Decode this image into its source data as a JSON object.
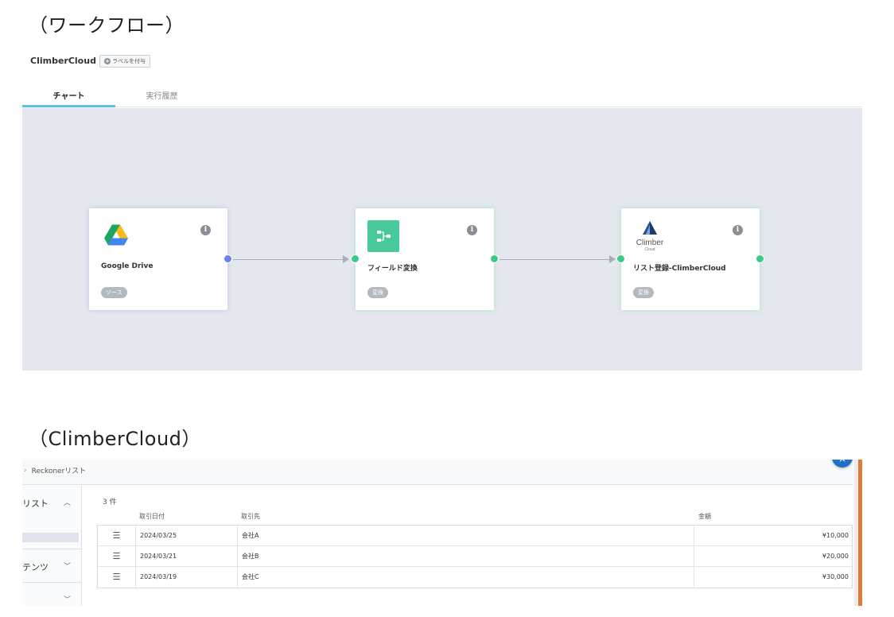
{
  "captions": {
    "workflow": "（ワークフロー）",
    "climbercloud": "（ClimberCloud）"
  },
  "workflow": {
    "title": "ClimberCloud",
    "add_label": "ラベルを付与",
    "tabs": [
      "チャート",
      "実行履歴"
    ],
    "active_tab": "チャート",
    "nodes": [
      {
        "name": "Google Drive",
        "badge": "ソース",
        "icon": "google-drive-icon"
      },
      {
        "name": "フィールド変換",
        "badge": "変換",
        "icon": "transform-icon"
      },
      {
        "name": "リスト登録-ClimberCloud",
        "badge": "変換",
        "icon": "climbercloud-icon",
        "logo_text": "Climber",
        "logo_sub": "Cloud"
      }
    ],
    "colors": {
      "canvas": "#e4e7ed",
      "port_source": "#6f7ff0",
      "port_ok": "#3cc98a",
      "tab_accent": "#5bc1ea",
      "transform_icon": "#47c99a"
    }
  },
  "climbercloud": {
    "breadcrumb": "Reckonerリスト",
    "sidebar": [
      {
        "label": "リスト",
        "chevron": "^"
      },
      {
        "label": "テンツ",
        "chevron": "v"
      },
      {
        "label": "",
        "chevron": "v"
      }
    ],
    "count": "3 件",
    "columns": [
      "取引日付",
      "取引先",
      "金額"
    ],
    "rows": [
      {
        "date": "2024/03/25",
        "partner": "会社A",
        "amount": "¥10,000"
      },
      {
        "date": "2024/03/21",
        "partner": "会社B",
        "amount": "¥20,000"
      },
      {
        "date": "2024/03/19",
        "partner": "会社C",
        "amount": "¥30,000"
      }
    ],
    "colors": {
      "close_button": "#1f6fc4",
      "accent_bar": "#e07c3a"
    }
  }
}
